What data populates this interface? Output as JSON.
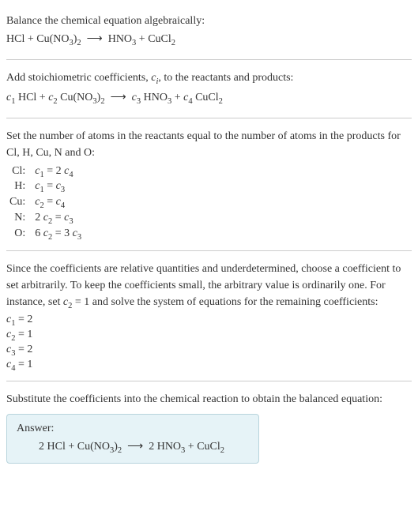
{
  "step1": {
    "title": "Balance the chemical equation algebraically:",
    "equation_html": "HCl + Cu(NO<sub>3</sub>)<sub>2</sub> &nbsp;⟶&nbsp; HNO<sub>3</sub> + CuCl<sub>2</sub>"
  },
  "step2": {
    "title_html": "Add stoichiometric coefficients, <span class='var'>c<sub>i</sub></span>, to the reactants and products:",
    "equation_html": "<span class='var'>c</span><sub>1</sub> HCl + <span class='var'>c</span><sub>2</sub> Cu(NO<sub>3</sub>)<sub>2</sub> &nbsp;⟶&nbsp; <span class='var'>c</span><sub>3</sub> HNO<sub>3</sub> + <span class='var'>c</span><sub>4</sub> CuCl<sub>2</sub>"
  },
  "step3": {
    "title": "Set the number of atoms in the reactants equal to the number of atoms in the products for Cl, H, Cu, N and O:",
    "rows": [
      {
        "atom": "Cl:",
        "eq_html": "<span class='var'>c</span><sub>1</sub> = 2 <span class='var'>c</span><sub>4</sub>"
      },
      {
        "atom": "H:",
        "eq_html": "<span class='var'>c</span><sub>1</sub> = <span class='var'>c</span><sub>3</sub>"
      },
      {
        "atom": "Cu:",
        "eq_html": "<span class='var'>c</span><sub>2</sub> = <span class='var'>c</span><sub>4</sub>"
      },
      {
        "atom": "N:",
        "eq_html": "2 <span class='var'>c</span><sub>2</sub> = <span class='var'>c</span><sub>3</sub>"
      },
      {
        "atom": "O:",
        "eq_html": "6 <span class='var'>c</span><sub>2</sub> = 3 <span class='var'>c</span><sub>3</sub>"
      }
    ]
  },
  "step4": {
    "text_html": "Since the coefficients are relative quantities and underdetermined, choose a coefficient to set arbitrarily. To keep the coefficients small, the arbitrary value is ordinarily one. For instance, set <span class='var'>c</span><sub>2</sub> = 1 and solve the system of equations for the remaining coefficients:",
    "coefs": [
      "<span class='var'>c</span><sub>1</sub> = 2",
      "<span class='var'>c</span><sub>2</sub> = 1",
      "<span class='var'>c</span><sub>3</sub> = 2",
      "<span class='var'>c</span><sub>4</sub> = 1"
    ]
  },
  "step5": {
    "title": "Substitute the coefficients into the chemical reaction to obtain the balanced equation:"
  },
  "answer": {
    "label": "Answer:",
    "equation_html": "2 HCl + Cu(NO<sub>3</sub>)<sub>2</sub> &nbsp;⟶&nbsp; 2 HNO<sub>3</sub> + CuCl<sub>2</sub>"
  }
}
